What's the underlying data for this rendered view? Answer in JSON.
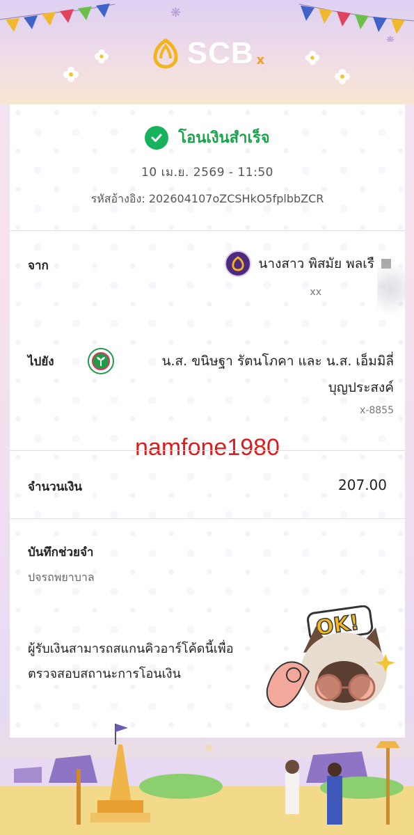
{
  "header": {
    "logo_text": "SCB",
    "logo_mark": "x",
    "brand_color": "#4d2a7f"
  },
  "status": {
    "icon": "check-circle-icon",
    "text": "โอนเงินสำเร็จ",
    "color": "#17a34a"
  },
  "datetime": "10 เม.ย. 2569 - 11:50",
  "reference": "รหัสอ้างอิง: 202604107oZCSHkO5fplbbZCR",
  "from": {
    "label": "จาก",
    "name": "นางสาว พิสมัย พลเรื",
    "account": "xx"
  },
  "to": {
    "label": "ไปยัง",
    "name_line1": "น.ส. ขนิษฐา รัตนโภคา และ น.ส. เอ็มมิลี่",
    "name_line2": "บุญประสงค์",
    "account": "x-8855"
  },
  "watermark": "namfone1980",
  "amount": {
    "label": "จำนวนเงิน",
    "value": "207.00"
  },
  "memo": {
    "label": "บันทึกช่วยจำ",
    "value": "ปจรถพยาบาล"
  },
  "qr_note": "ผู้รับเงินสามารถสแกนคิวอาร์โค้ดนี้เพื่อตรวจสอบสถานะการโอนเงิน",
  "sticker_text": "OK!"
}
